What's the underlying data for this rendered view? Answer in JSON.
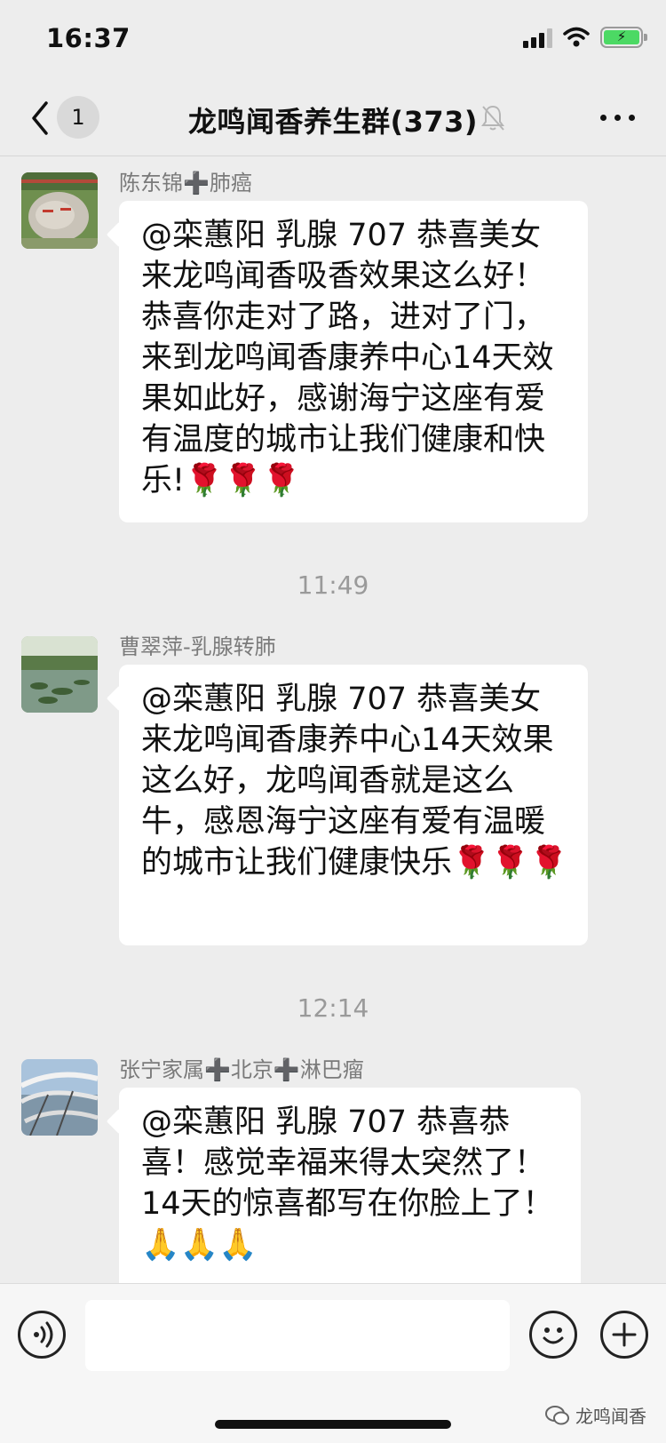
{
  "status_bar": {
    "time": "16:37"
  },
  "nav": {
    "back_badge": "1",
    "title": "龙鸣闻香养生群(373)"
  },
  "messages": [
    {
      "sender": "陈东锦➕肺癌",
      "text": "@栾蕙阳 乳腺 707 恭喜美女来龙鸣闻香吸香效果这么好！恭喜你走对了路，进对了门，来到龙鸣闻香康养中心14天效果如此好，感谢海宁这座有爱有温度的城市让我们健康和快乐!🌹🌹🌹",
      "avatar": "stone-avatar"
    },
    {
      "sender": "曹翠萍-乳腺转肺",
      "text": "@栾蕙阳 乳腺 707 恭喜美女来龙鸣闻香康养中心14天效果这么好，龙鸣闻香就是这么牛，感恩海宁这座有爱有温暖的城市让我们健康快乐🌹🌹🌹",
      "avatar": "lake-avatar"
    },
    {
      "sender": "张宁家属➕北京➕淋巴瘤",
      "text": "@栾蕙阳 乳腺 707 恭喜恭喜！感觉幸福来得太突然了！14天的惊喜都写在你脸上了！🙏🙏🙏",
      "avatar": "reed-avatar"
    }
  ],
  "timestamps": [
    "11:49",
    "12:14"
  ],
  "input": {
    "placeholder": ""
  },
  "watermark": "龙鸣闻香",
  "colors": {
    "background": "#ededed",
    "bubble": "#ffffff",
    "battery": "#4cd964"
  }
}
